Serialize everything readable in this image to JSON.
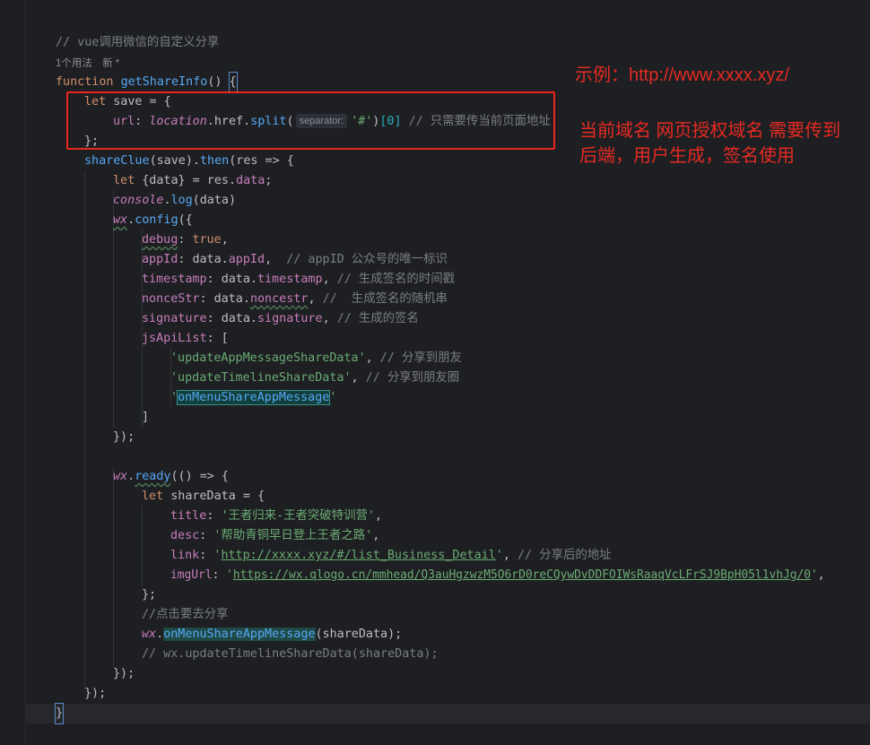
{
  "editor": {
    "comment_header": "// vue调用微信的自定义分享",
    "usage_hint": "1个用法",
    "usage_new": "新 *",
    "inlay_hint": "separator:",
    "lines": {
      "l01_kw": "function",
      "l01_fn": "getShareInfo",
      "l01_rest": "() ",
      "l01_brace": "{",
      "l02": "let save = {",
      "l03_prop": "url",
      "l03_glob": "location",
      "l03_a": ".href.",
      "l03_fn": "split",
      "l03_str": "'#'",
      "l03_idx": "[0]",
      "l03_cmt": "// 只需要传当前页面地址",
      "l04": "};",
      "l05_fn": "shareClue",
      "l05_rest": "(save).",
      "l05_then": "then",
      "l05_tail": "(res => {",
      "l06_kw": "let",
      "l06_rest": " {data} = res.",
      "l06_prop": "data",
      "l06_end": ";",
      "l07_glob": "console",
      "l07_dot": ".",
      "l07_fn": "log",
      "l07_rest": "(data)",
      "l08_glob": "wx",
      "l08_dot": ".",
      "l08_fn": "config",
      "l08_rest": "({",
      "l09_prop": "debug",
      "l09_kw": "true",
      "l10_prop": "appId",
      "l10_val": "data.",
      "l10_vp": "appId",
      "l10_cmt": "// appID 公众号的唯一标识",
      "l11_prop": "timestamp",
      "l11_val": "data.",
      "l11_vp": "timestamp",
      "l11_cmt": "// 生成签名的时间戳",
      "l12_prop": "nonceStr",
      "l12_val": "data.",
      "l12_vp": "noncestr",
      "l12_cmt": "//  生成签名的随机串",
      "l13_prop": "signature",
      "l13_val": "data.",
      "l13_vp": "signature",
      "l13_cmt": "// 生成的签名",
      "l14_prop": "jsApiList",
      "l15_str": "'updateAppMessageShareData'",
      "l15_cmt": "// 分享到朋友",
      "l16_str": "'updateTimelineShareData'",
      "l16_cmt": "// 分享到朋友圈",
      "l17_q1": "'",
      "l17_str": "onMenuShareAppMessage",
      "l17_q2": "'",
      "l18": "]",
      "l19": "});",
      "l21_glob": "wx",
      "l21_dot": ".",
      "l21_fn": "ready",
      "l21_rest": "(() => {",
      "l22_kw": "let",
      "l22_rest": " shareData = {",
      "l23_prop": "title",
      "l23_str": "'王者归来-王者突破特训营'",
      "l24_prop": "desc",
      "l24_str": "'帮助青铜早日登上王者之路'",
      "l25_prop": "link",
      "l25_q1": "'",
      "l25_url": "http://xxxx.xyz/#/list_Business_Detail",
      "l25_q2": "'",
      "l25_cmt": "// 分享后的地址",
      "l26_prop": "imgUrl",
      "l26_q1": "'",
      "l26_url": "https://wx.qlogo.cn/mmhead/Q3auHgzwzM5O6rD0reCQywDvDDFOIWsRaaqVcLFrSJ9BpH05l1vhJg/0",
      "l26_q2": "'",
      "l27": "};",
      "l28_cmt": "//点击要去分享",
      "l29_glob": "wx",
      "l29_dot": ".",
      "l29_fn": "onMenuShareAppMessage",
      "l29_rest": "(shareData);",
      "l30_cmt": "// wx.updateTimelineShareData(shareData);",
      "l31": "});",
      "l32": "});",
      "l33": "}"
    }
  },
  "annotations": {
    "example": "示例：http://www.xxxx.xyz/",
    "note_line1": "当前域名  网页授权域名 需要传到",
    "note_line2": "后端，用户生成，签名使用"
  },
  "colors": {
    "background": "#1e1f22",
    "keyword": "#cf8e6d",
    "function": "#56a8f5",
    "property": "#c77dbb",
    "string": "#6aab73",
    "comment": "#7a7e85",
    "annotation_red": "#e52a22"
  }
}
